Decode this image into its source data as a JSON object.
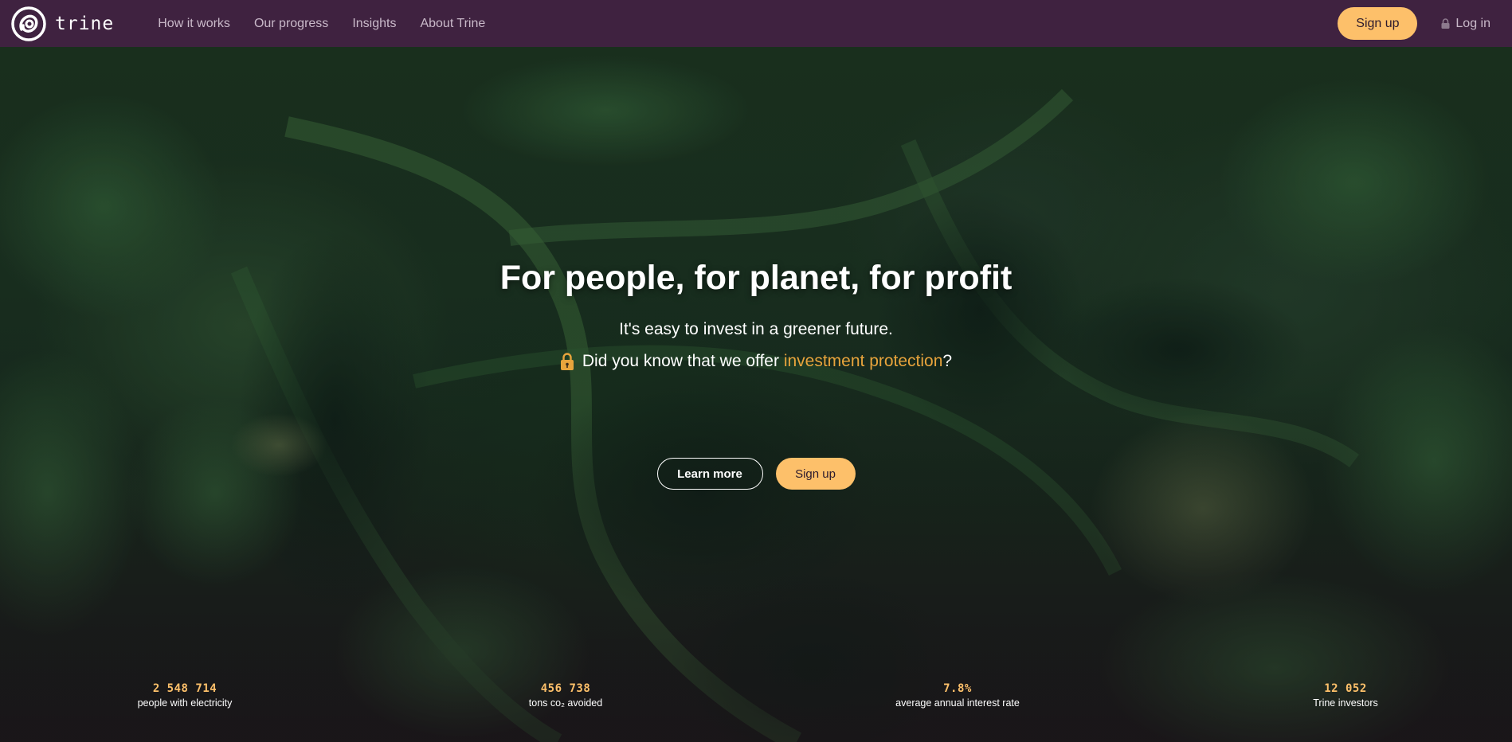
{
  "nav": {
    "brand": "trine",
    "links": [
      "How it works",
      "Our progress",
      "Insights",
      "About Trine"
    ],
    "signup_label": "Sign up",
    "login_label": "Log in"
  },
  "hero": {
    "headline": "For people, for planet, for profit",
    "subline": "It's easy to invest in a greener future.",
    "protection_prefix": "Did you know that we offer ",
    "protection_link": "investment protection",
    "protection_suffix": "?",
    "learn_more_label": "Learn more",
    "signup_label": "Sign up"
  },
  "stats": [
    {
      "value": "2 548 714",
      "label": "people with electricity"
    },
    {
      "value": "456 738",
      "label": "tons co₂ avoided"
    },
    {
      "value": "7.8%",
      "label": "average annual interest rate"
    },
    {
      "value": "12 052",
      "label": "Trine investors"
    }
  ],
  "colors": {
    "nav_bg": "#3f2240",
    "accent": "#fdc06a",
    "link_orange": "#e8a43c"
  }
}
